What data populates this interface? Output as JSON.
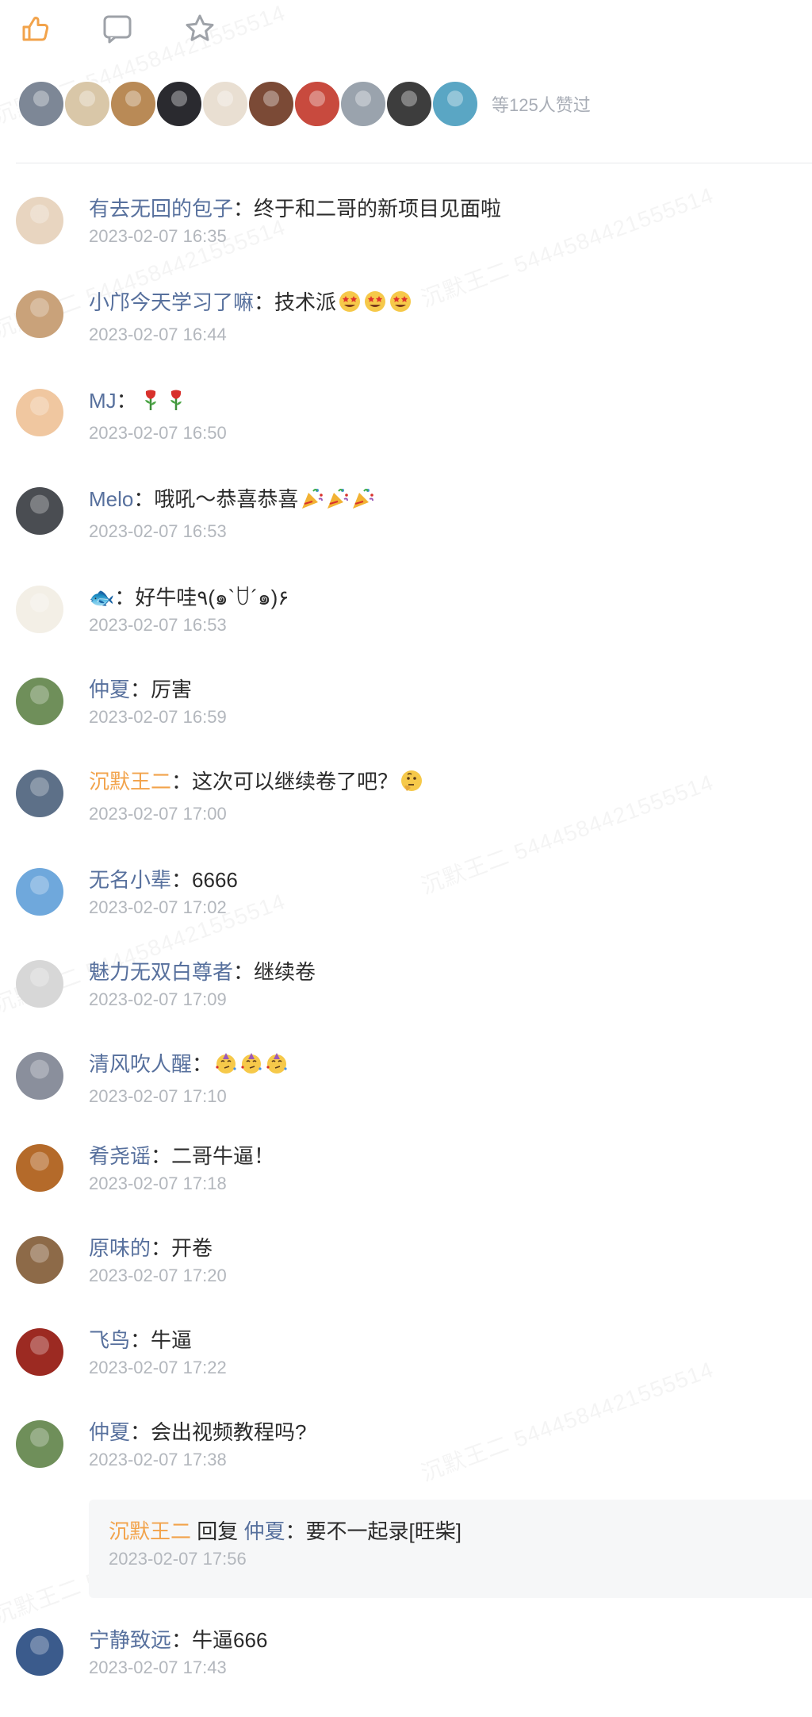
{
  "watermark": "沉默王二 5444584421555514",
  "action_bar": {
    "like_icon": "thumbs-up-icon",
    "comment_icon": "comment-bubble-icon",
    "favorite_icon": "star-icon",
    "accent": "#f2a34b"
  },
  "likers": {
    "count_label": "等125人赞过",
    "avatars": [
      {
        "name": "liker-1",
        "color": "#7d8796"
      },
      {
        "name": "liker-2",
        "color": "#d9c7a8"
      },
      {
        "name": "liker-3",
        "color": "#b98a56"
      },
      {
        "name": "liker-4",
        "color": "#2a2a2f"
      },
      {
        "name": "liker-5",
        "color": "#e9dfd2"
      },
      {
        "name": "liker-6",
        "color": "#7b4a36"
      },
      {
        "name": "liker-7",
        "color": "#c84a3e"
      },
      {
        "name": "liker-8",
        "color": "#9aa3ad"
      },
      {
        "name": "liker-9",
        "color": "#3d3d3d"
      },
      {
        "name": "liker-10",
        "color": "#5aa6c4"
      }
    ]
  },
  "comments": [
    {
      "author": "有去无回的包子",
      "sep": "：",
      "text": "终于和二哥的新项目见面啦",
      "time": "2023-02-07 16:35",
      "owner": false,
      "avatar_color": "#e8d5c0",
      "emoji": []
    },
    {
      "author": "小邝今天学习了嘛",
      "sep": "：",
      "text": "技术派",
      "time": "2023-02-07 16:44",
      "owner": false,
      "avatar_color": "#c9a27a",
      "emoji": [
        "star-struck-emoji",
        "star-struck-emoji",
        "star-struck-emoji"
      ]
    },
    {
      "author": "MJ",
      "sep": "：",
      "text": "",
      "time": "2023-02-07 16:50",
      "owner": false,
      "avatar_color": "#f0c7a0",
      "emoji": [
        "rose-emoji",
        "rose-emoji"
      ]
    },
    {
      "author": "Melo",
      "sep": "：",
      "text": "哦吼～恭喜恭喜",
      "time": "2023-02-07 16:53",
      "owner": false,
      "avatar_color": "#4a4d52",
      "emoji": [
        "party-popper-emoji",
        "party-popper-emoji",
        "party-popper-emoji"
      ]
    },
    {
      "author": "🐟",
      "sep": "：",
      "text": "好牛哇٩(๑`ꇴ´๑)۶",
      "time": "2023-02-07 16:53",
      "owner": false,
      "avatar_color": "#f3efe6",
      "emoji": []
    },
    {
      "author": "仲夏",
      "sep": "：",
      "text": "厉害",
      "time": "2023-02-07 16:59",
      "owner": false,
      "avatar_color": "#6f8f5a",
      "emoji": []
    },
    {
      "author": "沉默王二",
      "sep": "：",
      "text": "这次可以继续卷了吧？",
      "time": "2023-02-07 17:00",
      "owner": true,
      "avatar_color": "#5d7088",
      "emoji": [
        "thinking-emoji"
      ]
    },
    {
      "author": "无名小辈",
      "sep": "：",
      "text": "6666",
      "time": "2023-02-07 17:02",
      "owner": false,
      "avatar_color": "#6fa8dc",
      "emoji": []
    },
    {
      "author": "魅力无双白尊者",
      "sep": "：",
      "text": "继续卷",
      "time": "2023-02-07 17:09",
      "owner": false,
      "avatar_color": "#d7d7d7",
      "emoji": []
    },
    {
      "author": "清风吹人醒",
      "sep": "：",
      "text": "",
      "time": "2023-02-07 17:10",
      "owner": false,
      "avatar_color": "#8a8f9c",
      "emoji": [
        "partying-face-emoji",
        "partying-face-emoji",
        "partying-face-emoji"
      ]
    },
    {
      "author": "肴尧谣",
      "sep": "：",
      "text": "二哥牛逼！",
      "time": "2023-02-07 17:18",
      "owner": false,
      "avatar_color": "#b46a2a",
      "emoji": []
    },
    {
      "author": "原味的",
      "sep": "：",
      "text": "开卷",
      "time": "2023-02-07 17:20",
      "owner": false,
      "avatar_color": "#8d6a48",
      "emoji": []
    },
    {
      "author": "飞鸟",
      "sep": "：",
      "text": "牛逼",
      "time": "2023-02-07 17:22",
      "owner": false,
      "avatar_color": "#9c2a22",
      "emoji": []
    },
    {
      "author": "仲夏",
      "sep": "：",
      "text": "会出视频教程吗?",
      "time": "2023-02-07 17:38",
      "owner": false,
      "avatar_color": "#6f8f5a",
      "emoji": []
    },
    {
      "author": "宁静致远",
      "sep": "：",
      "text": "牛逼666",
      "time": "2023-02-07 17:43",
      "owner": false,
      "avatar_color": "#3b5b8c",
      "emoji": []
    }
  ],
  "reply": {
    "author": "沉默王二",
    "reply_word": "回复",
    "target": "仲夏",
    "sep": "：",
    "text": "要不一起录[旺柴]",
    "time": "2023-02-07 17:56"
  }
}
